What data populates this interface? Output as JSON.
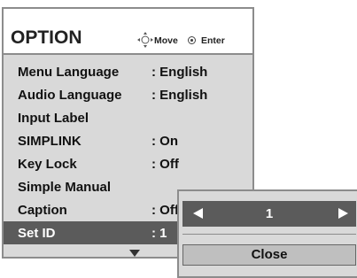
{
  "menu": {
    "title": "OPTION",
    "hints": {
      "move_icon": "four-way-arrow-icon",
      "move": "Move",
      "enter_icon": "enter-circle-icon",
      "enter": "Enter"
    },
    "items": [
      {
        "label": "Menu Language",
        "value": ": English"
      },
      {
        "label": "Audio Language",
        "value": ": English"
      },
      {
        "label": "Input Label",
        "value": ""
      },
      {
        "label": "SIMPLINK",
        "value": ": On"
      },
      {
        "label": "Key Lock",
        "value": ": Off"
      },
      {
        "label": "Simple Manual",
        "value": ""
      },
      {
        "label": "Caption",
        "value": ": Off"
      },
      {
        "label": "Set ID",
        "value": ": 1"
      }
    ],
    "selected_item": "Set ID"
  },
  "popup": {
    "value": "1",
    "left_arrow_icon": "left-triangle-icon",
    "right_arrow_icon": "right-triangle-icon",
    "close_label": "Close"
  },
  "colors": {
    "panel": "#d9d9d9",
    "border": "#8c8c8c",
    "selected": "#5b5b5b",
    "button": "#bfbfbf"
  }
}
